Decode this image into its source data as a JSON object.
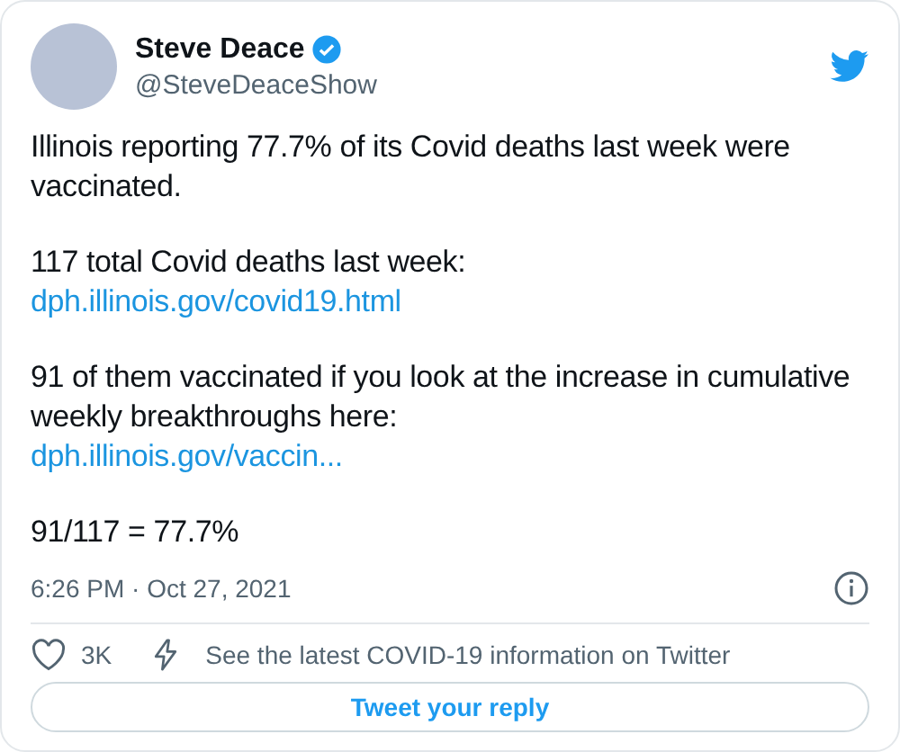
{
  "author": {
    "name": "Steve Deace",
    "handle": "@SteveDeaceShow",
    "verified": true
  },
  "body": [
    [
      {
        "kind": "text",
        "text": "Illinois reporting 77.7% of its Covid deaths last week were vaccinated."
      }
    ],
    [
      {
        "kind": "text",
        "text": "117 total Covid deaths last week:"
      },
      {
        "kind": "link",
        "text": "dph.illinois.gov/covid19.html"
      }
    ],
    [
      {
        "kind": "text",
        "text": "91 of them vaccinated if you look at the increase in cumulative weekly breakthroughs here:"
      },
      {
        "kind": "link",
        "text": "dph.illinois.gov/vaccin..."
      }
    ],
    [
      {
        "kind": "text",
        "text": "91/117 = 77.7%"
      }
    ]
  ],
  "timestamp": "6:26 PM · Oct 27, 2021",
  "likes": "3K",
  "info_link": "See the latest COVID-19 information on Twitter",
  "reply_button": "Tweet your reply"
}
